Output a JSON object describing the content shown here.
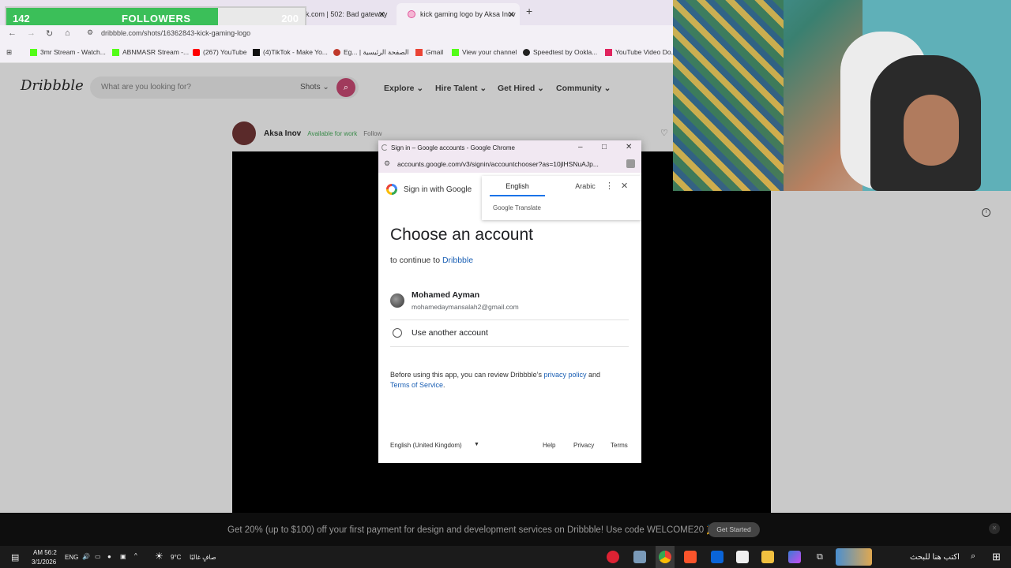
{
  "followers": {
    "current": "142",
    "label": "FOLLOWERS",
    "goal": "200",
    "progress": 0.71
  },
  "tabs": [
    {
      "title": "kick.com | 502: Bad gateway"
    },
    {
      "title": "kick gaming logo by Aksa Inov"
    }
  ],
  "address": {
    "url": "dribbble.com/shots/16362843-kick-gaming-logo"
  },
  "bookmarks": [
    "3mr Stream - Watch...",
    "ABNMASR Stream -...",
    "(267) YouTube",
    "(4)TikTok - Make Yo...",
    "Eg... | الصفحة الرئيسية",
    "Gmail",
    "View your channel",
    "Speedtest by Ookla...",
    "YouTube Video Do..."
  ],
  "dribbble": {
    "logo": "Dribbble",
    "search_placeholder": "What are you looking for?",
    "shots_label": "Shots",
    "nav": [
      "Explore",
      "Hire Talent",
      "Get Hired",
      "Community"
    ],
    "author": {
      "name": "Aksa Inov",
      "status": "Available for work",
      "follow": "Follow"
    }
  },
  "popup": {
    "window_title": "Sign in – Google accounts - Google Chrome",
    "url": "accounts.google.com/v3/signin/accountchooser?as=10jlHSNuAJp...",
    "header": "Sign in with Google",
    "translate": {
      "lang1": "English",
      "lang2": "Arabic",
      "brand": "Google Translate"
    },
    "heading": "Choose an account",
    "continue_prefix": "to continue to",
    "continue_app": "Dribbble",
    "account": {
      "name": "Mohamed Ayman",
      "email": "mohamedaymansalah2@gmail.com"
    },
    "use_another": "Use another account",
    "legal_prefix": "Before using this app, you can review Dribbble’s",
    "privacy_link": "privacy policy",
    "legal_and": "and",
    "terms_link": "Terms of Service",
    "footer": {
      "language": "English (United Kingdom)",
      "help": "Help",
      "privacy": "Privacy",
      "terms": "Terms"
    }
  },
  "promo": {
    "text": "Get 20% (up to $100) off your first payment for design and development services on Dribbble! Use code WELCOME20 🎉",
    "button": "Get Started"
  },
  "taskbar": {
    "time": "AM 56:2",
    "date": "3/1/2026",
    "lang": "ENG",
    "weather": "9°C",
    "weather_desc": "صافٍ غالبًا",
    "search_placeholder": "اكتب هنا للبحث"
  }
}
